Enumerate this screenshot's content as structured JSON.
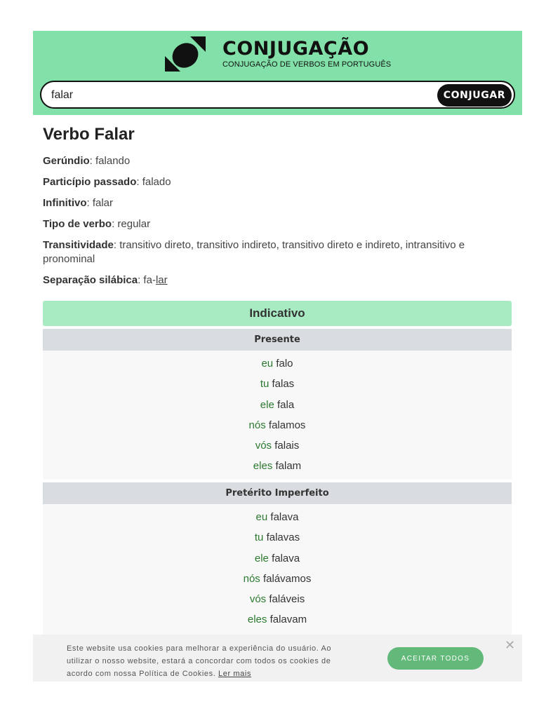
{
  "header": {
    "title": "CONJUGAÇÃO",
    "subtitle": "CONJUGAÇÃO DE VERBOS EM PORTUGUÊS",
    "logo_icon": "conjugacao-logo-icon",
    "background": "#82e0a9"
  },
  "search": {
    "value": "falar",
    "button_label": "CONJUGAR"
  },
  "verb": {
    "title": "Verbo Falar",
    "info": [
      {
        "label": "Gerúndio",
        "value": ": falando"
      },
      {
        "label": "Particípio passado",
        "value": ": falado"
      },
      {
        "label": "Infinitivo",
        "value": ": falar"
      },
      {
        "label": "Tipo de verbo",
        "value": ": regular"
      },
      {
        "label": "Transitividade",
        "value": ": transitivo direto, transitivo indireto, transitivo direto e indireto, intransitivo e pronominal"
      },
      {
        "label": "Separação silábica",
        "value": ": fa-",
        "underlined": "lar"
      }
    ]
  },
  "mood": {
    "label": "Indicativo",
    "tenses": [
      {
        "name": "Presente",
        "rows": [
          {
            "pronoun": "eu",
            "form": "falo"
          },
          {
            "pronoun": "tu",
            "form": "falas"
          },
          {
            "pronoun": "ele",
            "form": "fala"
          },
          {
            "pronoun": "nós",
            "form": "falamos"
          },
          {
            "pronoun": "vós",
            "form": "falais"
          },
          {
            "pronoun": "eles",
            "form": "falam"
          }
        ]
      },
      {
        "name": "Pretérito Imperfeito",
        "rows": [
          {
            "pronoun": "eu",
            "form": "falava"
          },
          {
            "pronoun": "tu",
            "form": "falavas"
          },
          {
            "pronoun": "ele",
            "form": "falava"
          },
          {
            "pronoun": "nós",
            "form": "falávamos"
          },
          {
            "pronoun": "vós",
            "form": "faláveis"
          },
          {
            "pronoun": "eles",
            "form": "falavam"
          }
        ]
      }
    ]
  },
  "cookie": {
    "text": "Este website usa cookies para melhorar a experiência do usuário. Ao utilizar o nosso website, estará a concordar com todos os cookies de acordo com nossa Política de Cookies.",
    "link": "Ler mais",
    "accept_label": "ACEITAR TODOS",
    "close_glyph": "✕"
  }
}
